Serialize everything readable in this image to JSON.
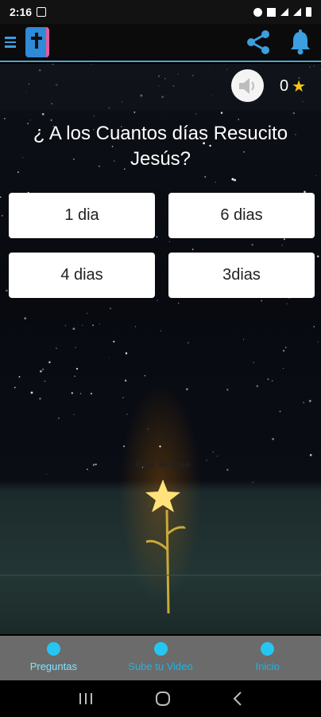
{
  "status_bar": {
    "time": "2:16"
  },
  "app_bar": {
    "icons": [
      "menu-icon",
      "bible-app-icon",
      "share-icon",
      "bell-icon"
    ]
  },
  "quiz": {
    "score": "0",
    "question": "¿ A los Cuantos días Resucito Jesús?",
    "answers": [
      "1 dia",
      "6 dias",
      "4 dias",
      "3dias"
    ],
    "watermark": "Dios Te Ama"
  },
  "bottom_nav": {
    "items": [
      {
        "label": "Preguntas",
        "active": true
      },
      {
        "label": "Sube tu Video",
        "active": false
      },
      {
        "label": "Inicio",
        "active": false
      }
    ]
  },
  "colors": {
    "accent": "#26c6f2",
    "appbar_icon": "#3b9fe0",
    "star": "#f5c518"
  }
}
